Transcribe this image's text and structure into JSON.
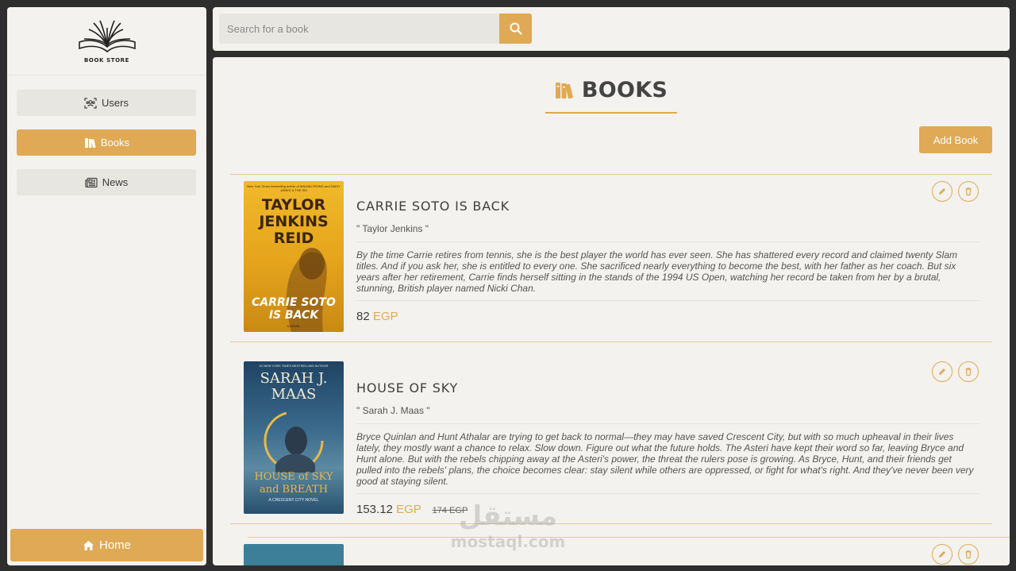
{
  "brand": {
    "logo_text": "BOOK STORE"
  },
  "sidebar": {
    "items": [
      {
        "label": "Users",
        "icon": "users-icon"
      },
      {
        "label": "Books",
        "icon": "books-icon",
        "active": true
      },
      {
        "label": "News",
        "icon": "newspaper-icon"
      }
    ],
    "home_label": "Home"
  },
  "search": {
    "placeholder": "Search for a book",
    "value": ""
  },
  "main": {
    "heading": "BOOKS",
    "add_button": "Add Book",
    "books": [
      {
        "title": "CARRIE SOTO IS BACK",
        "author": "\" Taylor Jenkins \"",
        "description": "By the time Carrie retires from tennis, she is the best player the world has ever seen. She has shattered every record and claimed twenty Slam titles. And if you ask her, she is entitled to every one. She sacrificed nearly everything to become the best, with her father as her coach. But six years after her retirement, Carrie finds herself sitting in the stands of the 1994 US Open, watching her record be taken from her by a brutal, stunning, British player named Nicki Chan.",
        "price": "82",
        "currency": "EGP",
        "old_price": "",
        "cover": {
          "top_line": "New York Times bestselling author of MALIBU RISING and DAISY JONES & THE SIX",
          "author_lines": [
            "TAYLOR",
            "JENKINS",
            "REID"
          ],
          "title_lines": [
            "CARRIE SOTO",
            "IS BACK"
          ],
          "subtitle": "A NOVEL",
          "bg": "#e8a920"
        }
      },
      {
        "title": "HOUSE OF SKY",
        "author": "\" Sarah J. Maas \"",
        "description": "Bryce Quinlan and Hunt Athalar are trying to get back to normal—they may have saved Crescent City, but with so much upheaval in their lives lately, they mostly want a chance to relax. Slow down. Figure out what the future holds. The Asteri have kept their word so far, leaving Bryce and Hunt alone. But with the rebels chipping away at the Asteri's power, the threat the rulers pose is growing. As Bryce, Hunt, and their friends get pulled into the rebels' plans, the choice becomes clear: stay silent while others are oppressed, or fight for what's right. And they've never been very good at staying silent.",
        "price": "153.12",
        "currency": "EGP",
        "old_price": "174 EGP",
        "cover": {
          "top_line": "#1 NEW YORK TIMES BESTSELLING AUTHOR",
          "author_lines": [
            "SARAH J.",
            "MAAS"
          ],
          "title_lines": [
            "HOUSE of SKY",
            "and BREATH"
          ],
          "subtitle": "A CRESCENT CITY NOVEL",
          "bg": "#2a4d6e"
        }
      }
    ]
  },
  "watermark": {
    "arabic": "مستقل",
    "latin": "mostaql.com"
  },
  "colors": {
    "accent": "#e0a955",
    "panel": "#f3f2ee",
    "background": "#2e2e2e"
  }
}
